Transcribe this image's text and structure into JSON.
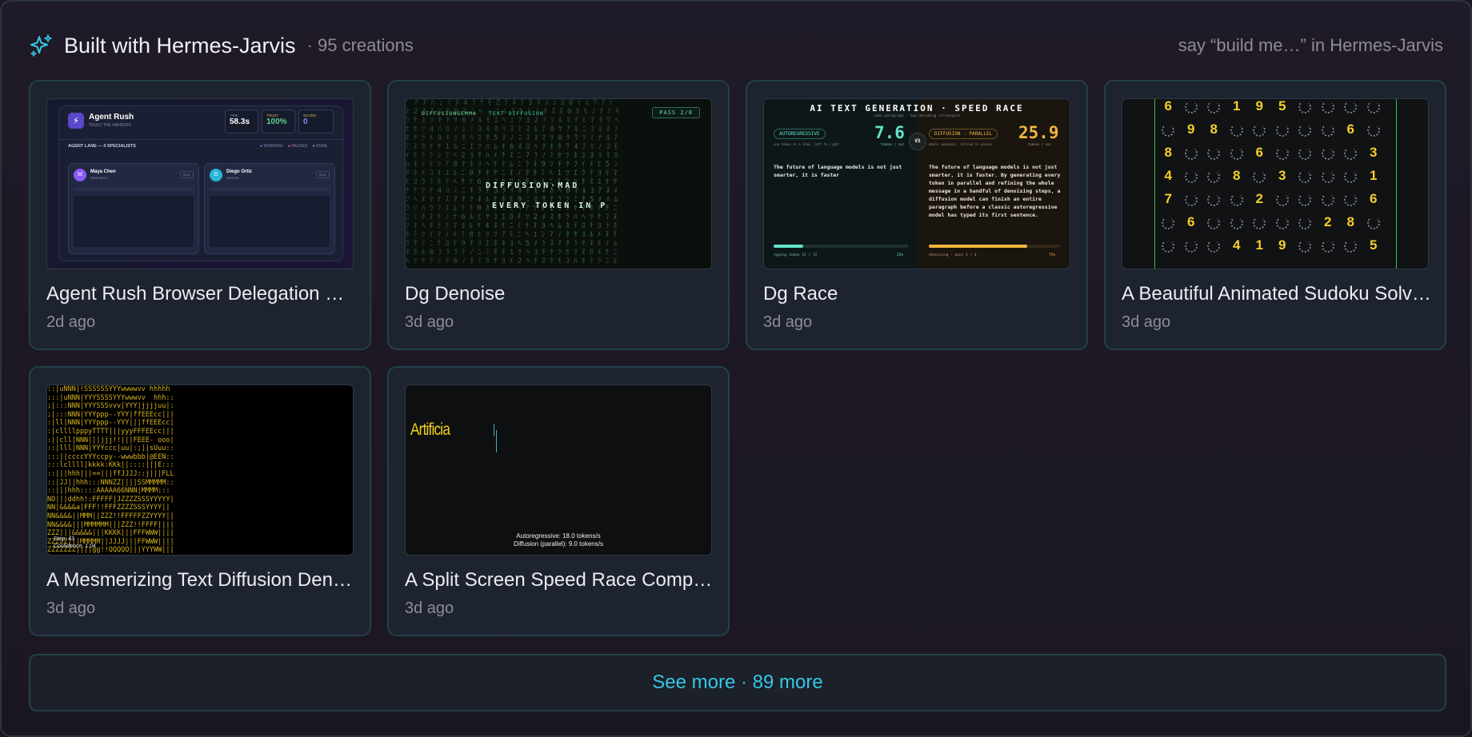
{
  "header": {
    "title": "Built with Hermes-Jarvis",
    "count": "· 95 creations",
    "hint": "say “build me…” in Hermes-Jarvis"
  },
  "cards": [
    {
      "title": "Agent Rush Browser Delegation G…",
      "time": "2d ago",
      "thumb": {
        "brand": "Agent Rush",
        "tagline": "TRUST THE HANDOFF",
        "time_label": "TIME",
        "time_value": "58.3s",
        "trust_label": "TRUST",
        "trust_value": "100%",
        "score_label": "SCORE",
        "score_value": "0",
        "lane_label": "AGENT LANE — 4 SPECIALISTS",
        "legend_working": "WORKING",
        "legend_paused": "PAUSED",
        "legend_done": "DONE",
        "agent1_name": "Maya Chen",
        "agent1_role": "RESEARCH",
        "agent1_initial": "M",
        "agent1_status": "IDLE",
        "agent2_name": "Diego Ortiz",
        "agent2_role": "DESIGN",
        "agent2_initial": "D",
        "agent2_status": "IDLE"
      }
    },
    {
      "title": "Dg Denoise",
      "time": "3d ago",
      "thumb": {
        "left_tag": "DIFFUSIONGEMMA",
        "center_tag": "TEXT DIFFUSION",
        "pass": "PASS 2/8",
        "line1": "DIFFUSION·MAD",
        "line2": "EVERY TOKEN IN P"
      }
    },
    {
      "title": "Dg Race",
      "time": "3d ago",
      "thumb": {
        "heading": "AI TEXT GENERATION · SPEED RACE",
        "subheading": "same paragraph · two decoding strategies",
        "left_badge": "AUTOREGRESSIVE",
        "left_speed": "7.6",
        "left_unit": "tokens / sec",
        "left_desc": "one token at a time, left to right",
        "left_text": "The future of language models is not just smarter, it is faster",
        "left_footer": "typing token 15 / 72",
        "left_pct": "22%",
        "vs": "VS",
        "right_badge": "DIFFUSION · PARALLEL",
        "right_speed": "25.9",
        "right_unit": "tokens / sec",
        "right_desc": "whole sequence, refined in passes",
        "right_text": "The future of language models is not just smarter, it is faster. By generating every token in parallel and refining the whole message in a handful of denoising steps, a diffusion model can finish an entire paragraph before a classic autoregressive model has typed its first sentence.",
        "right_footer": "denoising · pass 3 / 4",
        "right_pct": "75%"
      }
    },
    {
      "title": "A Beautiful Animated Sudoku Solv…",
      "time": "3d ago",
      "thumb": {
        "rows": [
          [
            "6",
            "",
            "",
            "1",
            "9",
            "5",
            "",
            "",
            "",
            ""
          ],
          [
            "",
            "9",
            "8",
            "",
            "",
            "",
            "",
            "",
            "6",
            ""
          ],
          [
            "8",
            "",
            "",
            "",
            "6",
            "",
            "",
            "",
            "",
            "3"
          ],
          [
            "4",
            "",
            "",
            "8",
            "",
            "3",
            "",
            "",
            "",
            "1"
          ],
          [
            "7",
            "",
            "",
            "",
            "2",
            "",
            "",
            "",
            "",
            "6"
          ],
          [
            "",
            "6",
            "",
            "",
            "",
            "",
            "",
            "2",
            "8",
            ""
          ],
          [
            "",
            "",
            "",
            "4",
            "1",
            "9",
            "",
            "",
            "",
            "5"
          ]
        ]
      }
    },
    {
      "title": "A Mesmerizing Text Diffusion Den…",
      "time": "3d ago",
      "thumb": {
        "step": "Step: 43",
        "confidence": "Confidence: 1.04"
      }
    },
    {
      "title": "A Split Screen Speed Race Compa…",
      "time": "3d ago",
      "thumb": {
        "word": "Artificia",
        "ar_line": "Autoregressive: 18.0 tokens/s",
        "diff_line": "Diffusion (parallel): 9.0 tokens/s"
      }
    }
  ],
  "see_more": "See more · 89 more",
  "colors": {
    "accent": "#36c7e6",
    "background": "#1c1722",
    "card": "#1e2330",
    "card_border": "#23404a"
  },
  "icons": {
    "header": "sparkle-icon"
  }
}
